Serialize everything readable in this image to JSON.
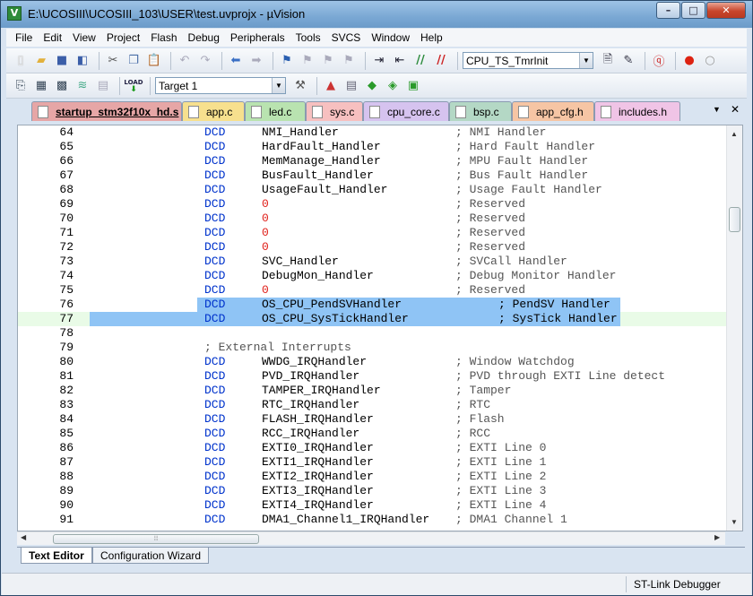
{
  "window": {
    "title": "E:\\UCOSIII\\UCOSIII_103\\USER\\test.uvprojx - µVision",
    "app_icon_letter": "V"
  },
  "caption": {
    "minimize": "–",
    "maximize": "□",
    "close": "✕"
  },
  "menu": [
    "File",
    "Edit",
    "View",
    "Project",
    "Flash",
    "Debug",
    "Peripherals",
    "Tools",
    "SVCS",
    "Window",
    "Help"
  ],
  "toolbar1": {
    "find_combo_value": "CPU_TS_TmrInit"
  },
  "toolbar2": {
    "target_combo_value": "Target 1",
    "load_label": "LOAD"
  },
  "tabs": [
    {
      "label": "startup_stm32f10x_hd.s",
      "color": "#e6a6a6",
      "active": true
    },
    {
      "label": "app.c",
      "color": "#f7e08e",
      "active": false
    },
    {
      "label": "led.c",
      "color": "#b9e3b0",
      "active": false
    },
    {
      "label": "sys.c",
      "color": "#f7c0c0",
      "active": false
    },
    {
      "label": "cpu_core.c",
      "color": "#d6c3ef",
      "active": false
    },
    {
      "label": "bsp.c",
      "color": "#b4d8c5",
      "active": false
    },
    {
      "label": "app_cfg.h",
      "color": "#f6c5a4",
      "active": false
    },
    {
      "label": "includes.h",
      "color": "#f0c4e6",
      "active": false
    }
  ],
  "tab_controls": {
    "dropdown": "▼",
    "close": "✕"
  },
  "code_lines": [
    {
      "n": "64",
      "kw": "DCD",
      "arg": "NMI_Handler",
      "cm": "; NMI Handler"
    },
    {
      "n": "65",
      "kw": "DCD",
      "arg": "HardFault_Handler",
      "cm": "; Hard Fault Handler"
    },
    {
      "n": "66",
      "kw": "DCD",
      "arg": "MemManage_Handler",
      "cm": "; MPU Fault Handler"
    },
    {
      "n": "67",
      "kw": "DCD",
      "arg": "BusFault_Handler",
      "cm": "; Bus Fault Handler"
    },
    {
      "n": "68",
      "kw": "DCD",
      "arg": "UsageFault_Handler",
      "cm": "; Usage Fault Handler"
    },
    {
      "n": "69",
      "kw": "DCD",
      "arg": "0",
      "cm": "; Reserved",
      "red": true
    },
    {
      "n": "70",
      "kw": "DCD",
      "arg": "0",
      "cm": "; Reserved",
      "red": true
    },
    {
      "n": "71",
      "kw": "DCD",
      "arg": "0",
      "cm": "; Reserved",
      "red": true
    },
    {
      "n": "72",
      "kw": "DCD",
      "arg": "0",
      "cm": "; Reserved",
      "red": true
    },
    {
      "n": "73",
      "kw": "DCD",
      "arg": "SVC_Handler",
      "cm": "; SVCall Handler"
    },
    {
      "n": "74",
      "kw": "DCD",
      "arg": "DebugMon_Handler",
      "cm": "; Debug Monitor Handler"
    },
    {
      "n": "75",
      "kw": "DCD",
      "arg": "0",
      "cm": "; Reserved",
      "red": true
    },
    {
      "n": "76",
      "kw": "DCD",
      "arg": "OS_CPU_PendSVHandler",
      "cm": "; PendSV Handler",
      "selected": true
    },
    {
      "n": "77",
      "kw": "DCD",
      "arg": "OS_CPU_SysTickHandler",
      "cm": "; SysTick Handler",
      "selected": true,
      "current": true
    },
    {
      "n": "78",
      "kw": "",
      "arg": "",
      "cm": ""
    },
    {
      "n": "79",
      "section": "; External Interrupts"
    },
    {
      "n": "80",
      "kw": "DCD",
      "arg": "WWDG_IRQHandler",
      "cm": "; Window Watchdog"
    },
    {
      "n": "81",
      "kw": "DCD",
      "arg": "PVD_IRQHandler",
      "cm": "; PVD through EXTI Line detect"
    },
    {
      "n": "82",
      "kw": "DCD",
      "arg": "TAMPER_IRQHandler",
      "cm": "; Tamper"
    },
    {
      "n": "83",
      "kw": "DCD",
      "arg": "RTC_IRQHandler",
      "cm": "; RTC"
    },
    {
      "n": "84",
      "kw": "DCD",
      "arg": "FLASH_IRQHandler",
      "cm": "; Flash"
    },
    {
      "n": "85",
      "kw": "DCD",
      "arg": "RCC_IRQHandler",
      "cm": "; RCC"
    },
    {
      "n": "86",
      "kw": "DCD",
      "arg": "EXTI0_IRQHandler",
      "cm": "; EXTI Line 0"
    },
    {
      "n": "87",
      "kw": "DCD",
      "arg": "EXTI1_IRQHandler",
      "cm": "; EXTI Line 1"
    },
    {
      "n": "88",
      "kw": "DCD",
      "arg": "EXTI2_IRQHandler",
      "cm": "; EXTI Line 2"
    },
    {
      "n": "89",
      "kw": "DCD",
      "arg": "EXTI3_IRQHandler",
      "cm": "; EXTI Line 3"
    },
    {
      "n": "90",
      "kw": "DCD",
      "arg": "EXTI4_IRQHandler",
      "cm": "; EXTI Line 4"
    },
    {
      "n": "91",
      "kw": "DCD",
      "arg": "DMA1_Channel1_IRQHandler",
      "cm": "; DMA1 Channel 1"
    }
  ],
  "bottom_tabs": [
    {
      "label": "Text Editor",
      "active": true
    },
    {
      "label": "Configuration Wizard",
      "active": false
    }
  ],
  "status": {
    "debugger": "ST-Link Debugger"
  }
}
